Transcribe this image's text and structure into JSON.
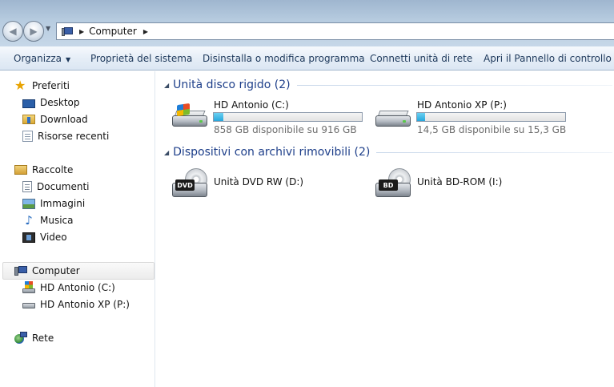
{
  "address": {
    "back_icon": "back-arrow-icon",
    "forward_icon": "forward-arrow-icon",
    "location_icon": "computer-icon",
    "path": "Computer"
  },
  "toolbar": {
    "organize": "Organizza",
    "system_properties": "Proprietà del sistema",
    "uninstall": "Disinstalla o modifica programma",
    "map_drive": "Connetti unità di rete",
    "control_panel": "Apri il Pannello di controllo"
  },
  "nav": {
    "favorites": "Preferiti",
    "desktop": "Desktop",
    "download": "Download",
    "recent": "Risorse recenti",
    "libraries": "Raccolte",
    "documents": "Documenti",
    "images": "Immagini",
    "music": "Musica",
    "video": "Video",
    "computer": "Computer",
    "drive_c": "HD Antonio (C:)",
    "drive_p": "HD Antonio XP (P:)",
    "network": "Rete"
  },
  "groups": {
    "hard_drives": "Unità disco rigido (2)",
    "removable": "Dispositivi con archivi rimovibili (2)"
  },
  "drives": [
    {
      "name": "HD Antonio (C:)",
      "free": "858 GB disponibile su 916 GB",
      "used_fraction": 0.063
    },
    {
      "name": "HD Antonio XP (P:)",
      "free": "14,5 GB disponibile su 15,3 GB",
      "used_fraction": 0.052
    }
  ],
  "removable": [
    {
      "name": "Unità DVD RW (D:)",
      "badge": "DVD"
    },
    {
      "name": "Unità BD-ROM (I:)",
      "badge": "BD"
    }
  ],
  "colors": {
    "accent": "#1e3f8a",
    "progress": "#27a7dc"
  }
}
